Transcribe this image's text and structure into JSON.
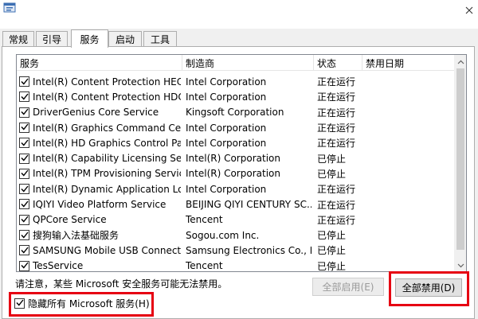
{
  "tabs": [
    {
      "label": "常规",
      "active": false
    },
    {
      "label": "引导",
      "active": false
    },
    {
      "label": "服务",
      "active": true
    },
    {
      "label": "启动",
      "active": false
    },
    {
      "label": "工具",
      "active": false
    }
  ],
  "table": {
    "columns": [
      "服务",
      "制造商",
      "状态",
      "禁用日期"
    ],
    "rows": [
      {
        "service": "Intel(R) Content Protection HECI ...",
        "manufacturer": "Intel Corporation",
        "status": "正在运行",
        "date": "",
        "checked": true
      },
      {
        "service": "Intel(R) Content Protection HDCP...",
        "manufacturer": "Intel Corporation",
        "status": "正在运行",
        "date": "",
        "checked": true
      },
      {
        "service": "DriverGenius Core Service",
        "manufacturer": "Kingsoft Corporation",
        "status": "正在运行",
        "date": "",
        "checked": true
      },
      {
        "service": "Intel(R) Graphics Command Cent...",
        "manufacturer": "Intel Corporation",
        "status": "正在运行",
        "date": "",
        "checked": true
      },
      {
        "service": "Intel(R) HD Graphics Control Pan...",
        "manufacturer": "Intel Corporation",
        "status": "正在运行",
        "date": "",
        "checked": true
      },
      {
        "service": "Intel(R) Capability Licensing Servi...",
        "manufacturer": "Intel(R) Corporation",
        "status": "已停止",
        "date": "",
        "checked": true
      },
      {
        "service": "Intel(R) TPM Provisioning Service",
        "manufacturer": "Intel(R) Corporation",
        "status": "已停止",
        "date": "",
        "checked": true
      },
      {
        "service": "Intel(R) Dynamic Application Loa...",
        "manufacturer": "Intel Corporation",
        "status": "正在运行",
        "date": "",
        "checked": true
      },
      {
        "service": "IQIYI Video Platform Service",
        "manufacturer": "BEIJING QIYI CENTURY SC...",
        "status": "正在运行",
        "date": "",
        "checked": true
      },
      {
        "service": "QPCore Service",
        "manufacturer": "Tencent",
        "status": "正在运行",
        "date": "",
        "checked": true
      },
      {
        "service": "搜狗输入法基础服务",
        "manufacturer": "Sogou.com Inc.",
        "status": "已停止",
        "date": "",
        "checked": true
      },
      {
        "service": "SAMSUNG Mobile USB Connecti...",
        "manufacturer": "Samsung Electronics Co., L...",
        "status": "已停止",
        "date": "",
        "checked": true
      },
      {
        "service": "TesService",
        "manufacturer": "Tencent",
        "status": "已停止",
        "date": "",
        "checked": true
      }
    ]
  },
  "notice": "请注意，某些 Microsoft 安全服务可能无法禁用。",
  "buttons": {
    "enable_all": "全部启用(E)",
    "disable_all": "全部禁用(D)"
  },
  "hide_ms": {
    "label": "隐藏所有 Microsoft 服务(H)",
    "checked": true
  },
  "icons": {
    "app": "msconfig-icon",
    "close": "close-icon",
    "check": "check-icon",
    "scroll_up": "chevron-up-icon",
    "scroll_down": "chevron-down-icon"
  },
  "colors": {
    "highlight": "#e60012",
    "window_bg": "#f0f0f0"
  }
}
